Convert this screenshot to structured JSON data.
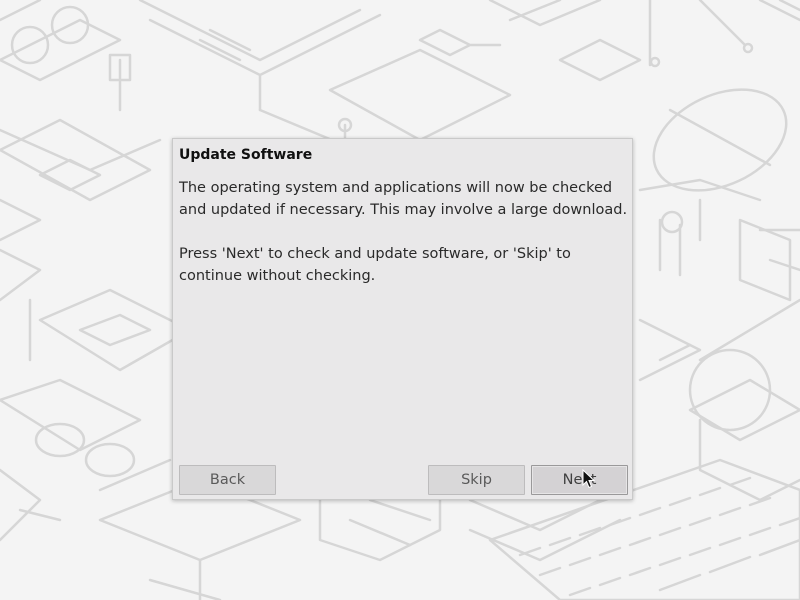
{
  "dialog": {
    "title": "Update Software",
    "paragraph1": "The operating system and applications will now be checked and updated if necessary. This may involve a large download.",
    "paragraph2": "Press 'Next' to check and update software, or 'Skip' to continue without checking.",
    "buttons": {
      "back": "Back",
      "skip": "Skip",
      "next": "Next"
    }
  },
  "colors": {
    "wallpaper_bg": "#f4f4f4",
    "wallpaper_lines": "#d8d8d8",
    "dialog_bg": "#e9e8e9",
    "button_bg": "#d9d8d9"
  },
  "icons": {
    "cursor": "arrow-pointer-icon"
  }
}
